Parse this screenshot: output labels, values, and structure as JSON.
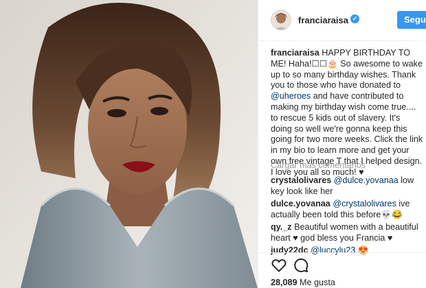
{
  "post": {
    "username": "franciaraisa",
    "follow_label": "Seguir"
  },
  "caption": {
    "username": "franciaraisa",
    "text_1": "HAPPY BIRTHDAY TO ME! Haha!☐☐🎂 So awesome to wake up to so many birthday wishes. Thank you to those who have donated to ",
    "mention": "@uheroes",
    "text_2": " and have contributed to making my birthday wish come true.... to rescue 5 kids out of slavery. It's doing so well we're gonna keep this going for two more weeks. Click the link in my bio to learn more and get your own free vintage T that I helped design. I love you all so much! ♥"
  },
  "load_more_label": "Cargar más comentarios",
  "comments": [
    {
      "username": "crystalolivares",
      "mention": "@dulce.yovanaa",
      "text": " low key look like her"
    },
    {
      "username": "dulce.yovanaa",
      "mention": "@crystalolivares",
      "text": " ive actually been told this before💀😂"
    },
    {
      "username": "qy._z",
      "mention": "",
      "text": "Beautiful women with a beautiful heart ♥ god bless you Francia ♥"
    },
    {
      "username": "judy22dc",
      "mention": "@luccylu23",
      "text": " 😍"
    }
  ],
  "likes": {
    "count": "28,089",
    "label": "Me gusta"
  },
  "colors": {
    "accent": "#3897f0",
    "mention": "#003569",
    "muted": "#999999"
  },
  "icons": [
    "heart-icon",
    "comment-icon",
    "verified-badge-icon"
  ]
}
